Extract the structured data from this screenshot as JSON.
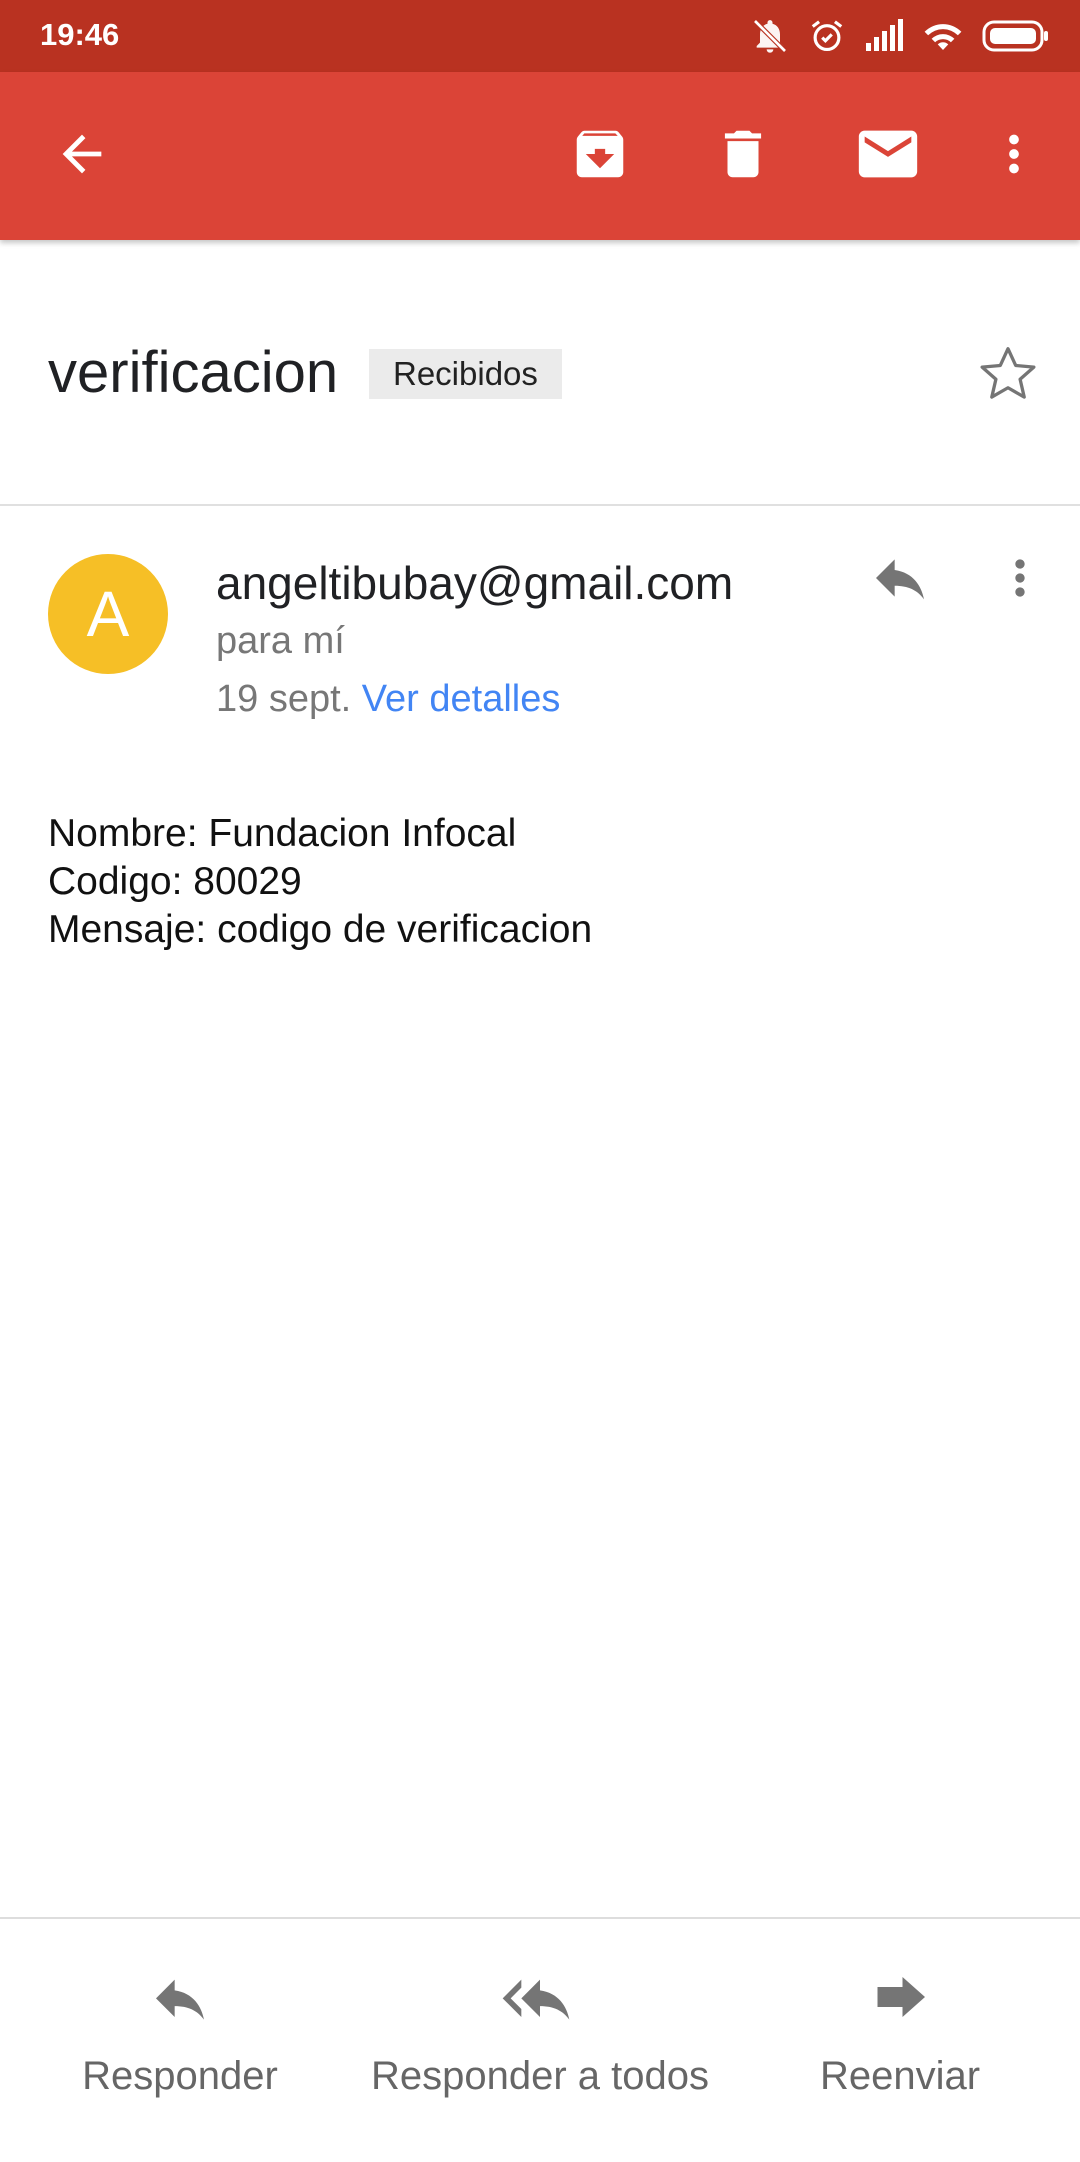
{
  "status_bar": {
    "time": "19:46",
    "icons": [
      "bell-off-icon",
      "alarm-icon",
      "signal-icon",
      "wifi-icon",
      "battery-icon"
    ]
  },
  "toolbar": {
    "icons": [
      "back-arrow-icon",
      "archive-icon",
      "delete-icon",
      "mark-unread-icon",
      "more-vert-icon"
    ],
    "background": "#db4437"
  },
  "email": {
    "subject": "verificacion",
    "label": "Recibidos",
    "sender": {
      "avatar_letter": "A",
      "avatar_color": "#f6bf26",
      "address": "angeltibubay@gmail.com",
      "to": "para mí",
      "date": "19 sept.",
      "details_link": "Ver detalles"
    },
    "body": {
      "line1": "Nombre: Fundacion Infocal",
      "line2": "Codigo: 80029",
      "line3": "Mensaje: codigo de verificacion"
    }
  },
  "bottom_actions": {
    "reply": "Responder",
    "reply_all": "Responder a todos",
    "forward": "Reenviar"
  }
}
